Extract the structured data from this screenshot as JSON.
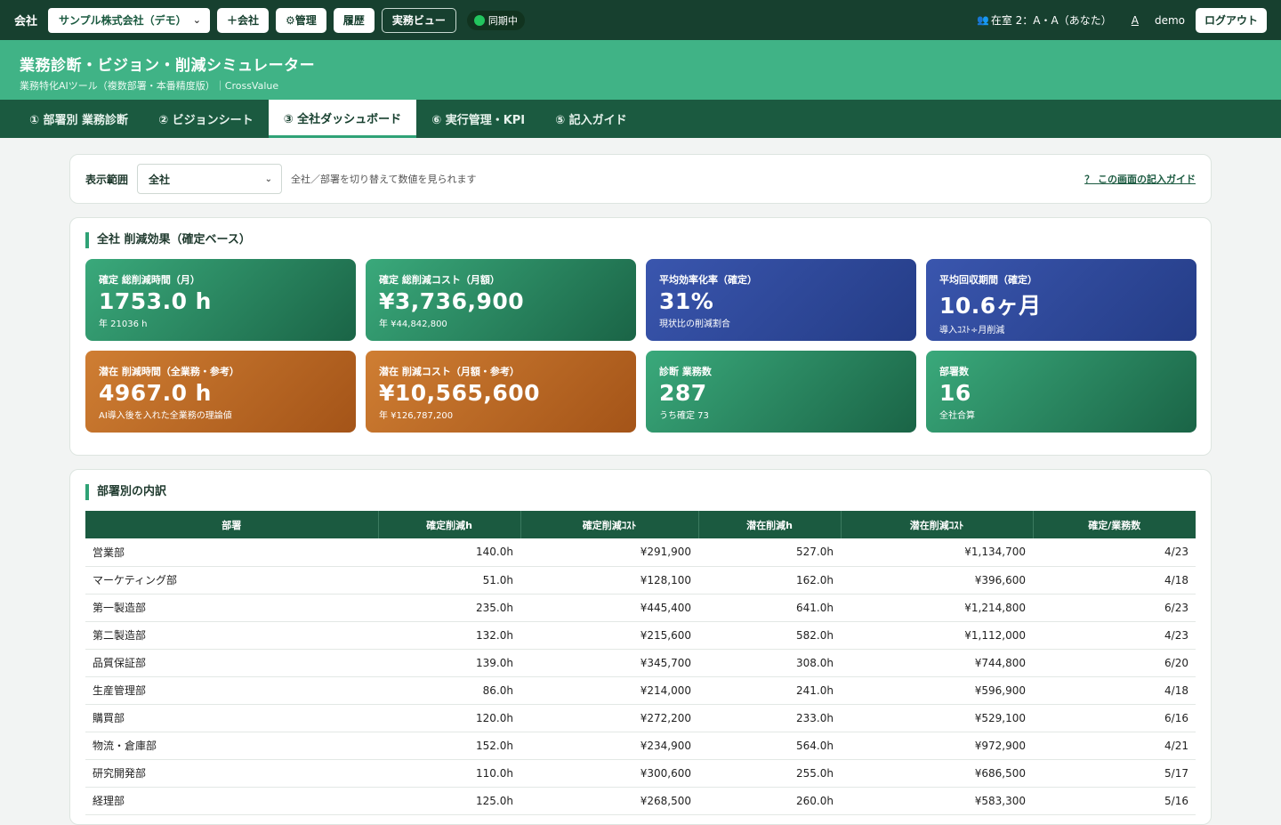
{
  "topbar": {
    "company_label": "会社",
    "company_select": "サンプル株式会社（デモ）",
    "add_company": "＋会社",
    "admin": "⚙管理",
    "history": "履歴",
    "work_view": "実務ビュー",
    "sync_status": "同期中",
    "presence": "在室 2：A・A（あなた）",
    "font_toggle": "A",
    "user": "demo",
    "logout": "ログアウト"
  },
  "header": {
    "title": "業務診断・ビジョン・削減シミュレーター",
    "subtitle": "業務特化AIツール（複数部署・本番精度版）｜CrossValue"
  },
  "tabs": [
    {
      "label": "① 部署別 業務診断"
    },
    {
      "label": "② ビジョンシート"
    },
    {
      "label": "③ 全社ダッシュボード"
    },
    {
      "label": "⑥ 実行管理・KPI"
    },
    {
      "label": "⑤ 記入ガイド"
    }
  ],
  "scope": {
    "label": "表示範囲",
    "selected": "全社",
    "hint": "全社／部署を切り替えて数値を見られます",
    "guide_link": "？ この画面の記入ガイド"
  },
  "kpis": {
    "title": "全社 削減効果（確定ベース）",
    "items": [
      {
        "label": "確定 総削減時間（月）",
        "value": "1753.0 h",
        "sub": "年 21036 h",
        "color": "#2f8f66"
      },
      {
        "label": "確定 総削減コスト（月額）",
        "value": "¥3,736,900",
        "sub": "年 ¥44,842,800",
        "color": "#2f8f66"
      },
      {
        "label": "平均効率化率（確定）",
        "value": "31%",
        "sub": "現状比の削減割合",
        "color": "#2f4a9e"
      },
      {
        "label": "平均回収期間（確定）",
        "value": "10.6ヶ月",
        "sub": "導入ｺｽﾄ÷月削減",
        "color": "#2f4a9e"
      },
      {
        "label": "潜在 削減時間（全業務・参考）",
        "value": "4967.0 h",
        "sub": "AI導入後を入れた全業務の理論値",
        "color": "#bd6a25"
      },
      {
        "label": "潜在 削減コスト（月額・参考）",
        "value": "¥10,565,600",
        "sub": "年 ¥126,787,200",
        "color": "#bd6a25"
      },
      {
        "label": "診断 業務数",
        "value": "287",
        "sub": "うち確定 73",
        "color": "#2f8f66"
      },
      {
        "label": "部署数",
        "value": "16",
        "sub": "全社合算",
        "color": "#2f8f66"
      }
    ]
  },
  "breakdown": {
    "title": "部署別の内訳",
    "columns": [
      "部署",
      "確定削減h",
      "確定削減ｺｽﾄ",
      "潜在削減h",
      "潜在削減ｺｽﾄ",
      "確定/業務数"
    ],
    "rows": [
      [
        "営業部",
        "140.0h",
        "¥291,900",
        "527.0h",
        "¥1,134,700",
        "4/23"
      ],
      [
        "マーケティング部",
        "51.0h",
        "¥128,100",
        "162.0h",
        "¥396,600",
        "4/18"
      ],
      [
        "第一製造部",
        "235.0h",
        "¥445,400",
        "641.0h",
        "¥1,214,800",
        "6/23"
      ],
      [
        "第二製造部",
        "132.0h",
        "¥215,600",
        "582.0h",
        "¥1,112,000",
        "4/23"
      ],
      [
        "品質保証部",
        "139.0h",
        "¥345,700",
        "308.0h",
        "¥744,800",
        "6/20"
      ],
      [
        "生産管理部",
        "86.0h",
        "¥214,000",
        "241.0h",
        "¥596,900",
        "4/18"
      ],
      [
        "購買部",
        "120.0h",
        "¥272,200",
        "233.0h",
        "¥529,100",
        "6/16"
      ],
      [
        "物流・倉庫部",
        "152.0h",
        "¥234,900",
        "564.0h",
        "¥972,900",
        "4/21"
      ],
      [
        "研究開発部",
        "110.0h",
        "¥300,600",
        "255.0h",
        "¥686,500",
        "5/17"
      ],
      [
        "経理部",
        "125.0h",
        "¥268,500",
        "260.0h",
        "¥583,300",
        "5/16"
      ]
    ]
  }
}
